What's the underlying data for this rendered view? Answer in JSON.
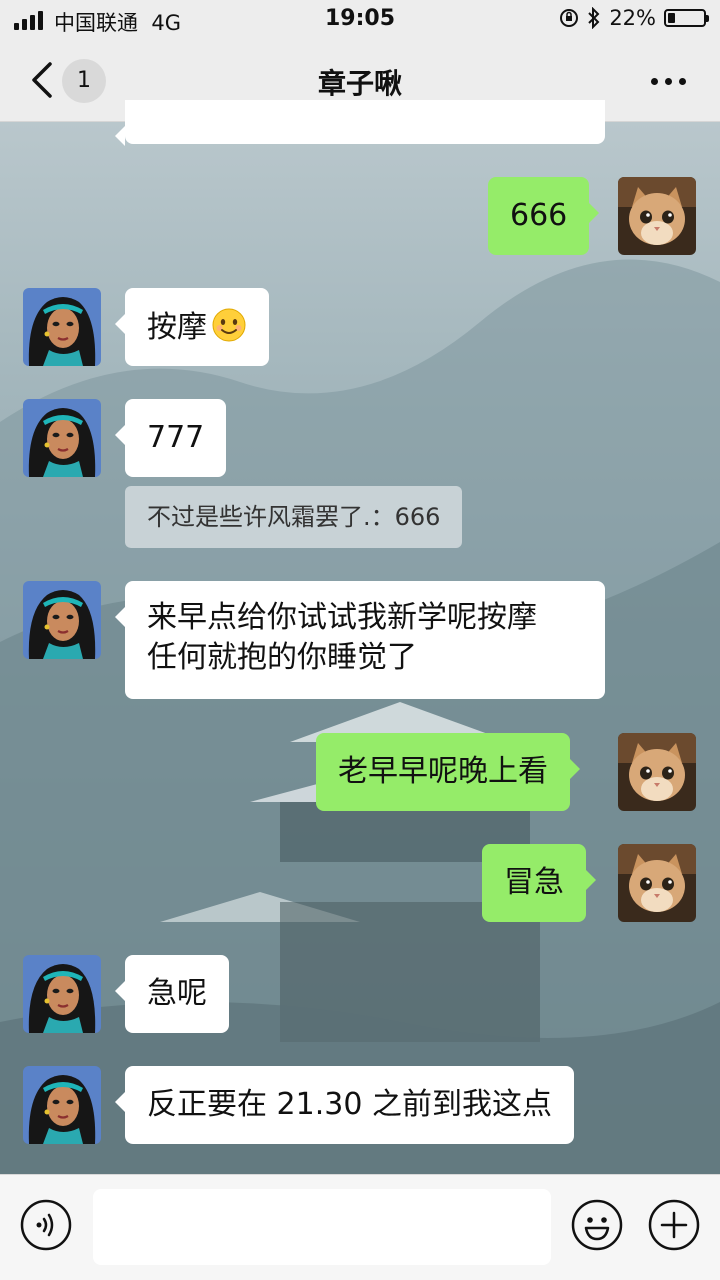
{
  "status_bar": {
    "carrier": "中国联通",
    "network": "4G",
    "time": "19:05",
    "battery_percent": "22%",
    "battery_level": 0.22
  },
  "nav": {
    "unread_count": "1",
    "title": "章子啾"
  },
  "messages": [
    {
      "side": "right",
      "sender": "me",
      "text": "666"
    },
    {
      "side": "left",
      "sender": "contact",
      "text": "按摩",
      "emoji": "slightly-smiling-face"
    },
    {
      "side": "left",
      "sender": "contact",
      "text": "777",
      "quote": "不过是些许风霜罢了.：666"
    },
    {
      "side": "left",
      "sender": "contact",
      "text_lines": [
        "来早点给你试试我新学呢按摩",
        "任何就抱的你睡觉了"
      ]
    },
    {
      "side": "right",
      "sender": "me",
      "text": "老早早呢晚上看"
    },
    {
      "side": "right",
      "sender": "me",
      "text": "冒急"
    },
    {
      "side": "left",
      "sender": "contact",
      "text": "急呢"
    },
    {
      "side": "left",
      "sender": "contact",
      "text": "反正要在 21.30 之前到我这点"
    }
  ],
  "input": {
    "value": "",
    "placeholder": ""
  },
  "colors": {
    "my_bubble": "#95ec69",
    "their_bubble": "#ffffff",
    "bar_background": "#ededed"
  },
  "icons": [
    "back-icon",
    "more-icon",
    "voice-icon",
    "emoji-icon",
    "add-icon"
  ]
}
